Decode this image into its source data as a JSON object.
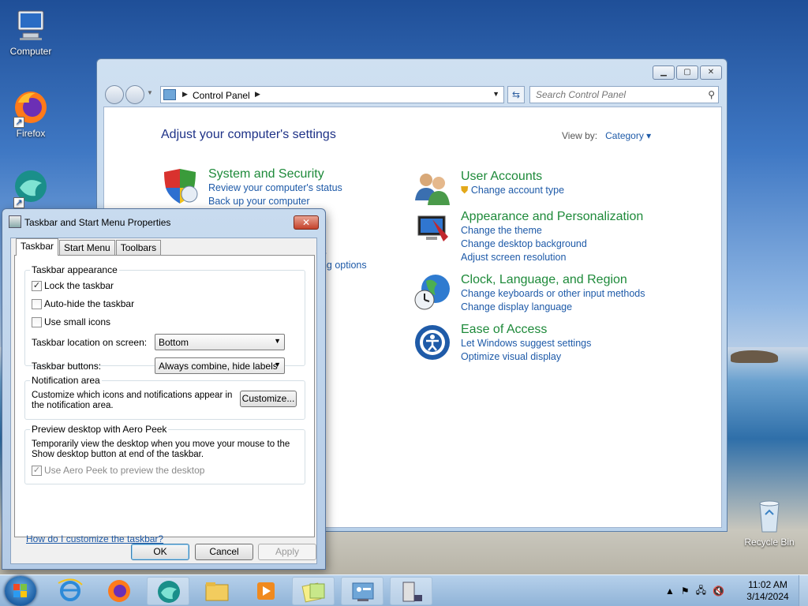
{
  "desktop": {
    "icons": [
      {
        "label": "Computer"
      },
      {
        "label": "Firefox"
      },
      {
        "label": ""
      },
      {
        "label": "Recycle Bin"
      }
    ]
  },
  "control_panel": {
    "breadcrumb": "Control Panel",
    "search_placeholder": "Search Control Panel",
    "heading": "Adjust your computer's settings",
    "view_by_label": "View by:",
    "view_by_value": "Category",
    "categories": [
      {
        "title": "System and Security",
        "icon": "shield-icon",
        "links": [
          "Review your computer's status",
          "Back up your computer"
        ]
      },
      {
        "title": "User Accounts",
        "icon": "users-icon",
        "links": [
          "Change account type"
        ]
      },
      {
        "title": "Appearance and Personalization",
        "icon": "display-icon",
        "links": [
          "Change the theme",
          "Change desktop background",
          "Adjust screen resolution"
        ]
      },
      {
        "title": "Clock, Language, and Region",
        "icon": "globe-clock-icon",
        "links": [
          "Change keyboards or other input methods",
          "Change display language"
        ]
      },
      {
        "title": "Ease of Access",
        "icon": "ease-of-access-icon",
        "links": [
          "Let Windows suggest settings",
          "Optimize visual display"
        ]
      }
    ],
    "partial_links": [
      "ts",
      "ring options"
    ]
  },
  "dialog": {
    "title": "Taskbar and Start Menu Properties",
    "tabs": [
      "Taskbar",
      "Start Menu",
      "Toolbars"
    ],
    "active_tab": "Taskbar",
    "appearance": {
      "label": "Taskbar appearance",
      "lock": {
        "label": "Lock the taskbar",
        "checked": true
      },
      "autohide": {
        "label": "Auto-hide the taskbar",
        "checked": false
      },
      "small_icons": {
        "label": "Use small icons",
        "checked": false
      },
      "location_label": "Taskbar location on screen:",
      "location_value": "Bottom",
      "buttons_label": "Taskbar buttons:",
      "buttons_value": "Always combine, hide labels"
    },
    "notification": {
      "label": "Notification area",
      "text": "Customize which icons and notifications appear in the notification area.",
      "button": "Customize..."
    },
    "aero": {
      "label": "Preview desktop with Aero Peek",
      "text": "Temporarily view the desktop when you move your mouse to the Show desktop button at end of the taskbar.",
      "checkbox": {
        "label": "Use Aero Peek to preview the desktop",
        "checked": true,
        "disabled": true
      }
    },
    "help_link": "How do I customize the taskbar?",
    "buttons": {
      "ok": "OK",
      "cancel": "Cancel",
      "apply": "Apply"
    }
  },
  "taskbar": {
    "time": "11:02 AM",
    "date": "3/14/2024"
  }
}
